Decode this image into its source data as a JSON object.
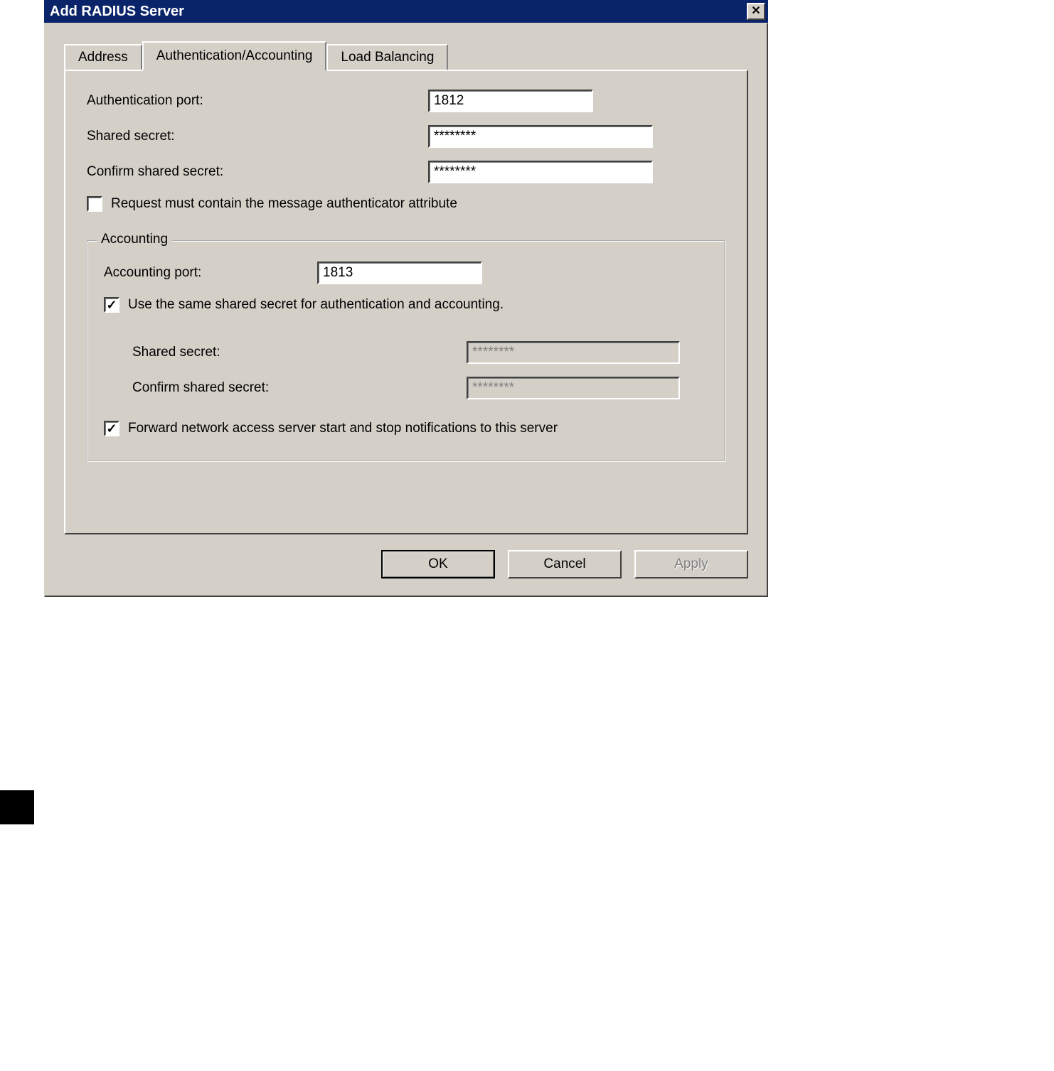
{
  "window": {
    "title": "Add RADIUS Server"
  },
  "tabs": {
    "address": "Address",
    "auth": "Authentication/Accounting",
    "load": "Load Balancing"
  },
  "auth_section": {
    "port_label": "Authentication port:",
    "port_value": "1812",
    "secret_label": "Shared secret:",
    "secret_value": "********",
    "confirm_label": "Confirm shared secret:",
    "confirm_value": "********",
    "request_authenticator_label": "Request must contain the message authenticator attribute",
    "request_authenticator_checked": false
  },
  "acct_group": {
    "title": "Accounting",
    "port_label": "Accounting port:",
    "port_value": "1813",
    "same_secret_label": "Use the same shared secret for authentication and accounting.",
    "same_secret_checked": true,
    "secret_label": "Shared secret:",
    "secret_value": "********",
    "confirm_label": "Confirm shared secret:",
    "confirm_value": "********",
    "forward_label": "Forward network access server start and stop notifications to this server",
    "forward_checked": true
  },
  "buttons": {
    "ok": "OK",
    "cancel": "Cancel",
    "apply": "Apply"
  }
}
